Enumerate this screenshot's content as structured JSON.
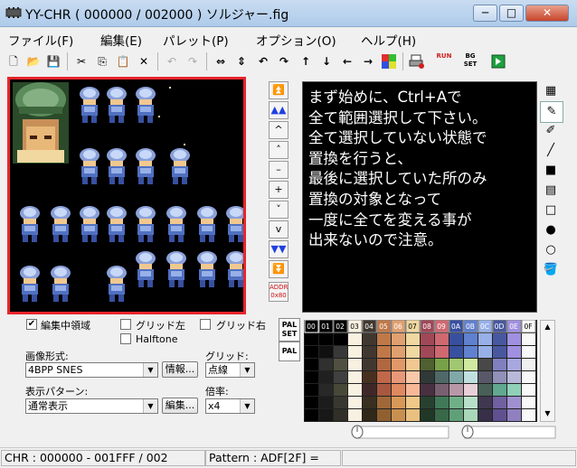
{
  "window": {
    "title": "YY-CHR ( 000000 / 002000 ) ソルジャー.fig",
    "min_glyph": "─",
    "max_glyph": "□",
    "close_glyph": "✕"
  },
  "menu": [
    "ファイル(F)",
    "編集(E)",
    "パレット(P)",
    "オプション(O)",
    "ヘルプ(H)"
  ],
  "toolbar": {
    "new": "🗋",
    "open": "📂",
    "save": "💾",
    "cut": "✂",
    "copy": "⎘",
    "paste": "📋",
    "delete": "✕",
    "undo": "↶",
    "redo": "↷",
    "flip_h": "⇔",
    "flip_v": "⇕",
    "rot_l": "↶",
    "rot_r": "↷",
    "up": "↑",
    "down": "↓",
    "left": "←",
    "right": "→",
    "bg_label": "BG SET",
    "run_label": "RUN"
  },
  "scroll_buttons": [
    "⏫",
    "▲▲",
    "^",
    "˄",
    "–",
    "+",
    "˅",
    "v",
    "▼▼",
    "⏬"
  ],
  "addr_button": {
    "line1": "ADDR",
    "line2": "0x80"
  },
  "edit_panel": {
    "text": "まず始めに、Ctrl+Aで\n全て範囲選択して下さい。\n全て選択していない状態で\n置換を行うと、\n最後に選択していた所のみ\n置換の対象となって\n一度に全てを変える事が\n出来ないので注意。"
  },
  "tools": [
    "▦",
    "✎",
    "✐",
    "╱",
    "■",
    "▤",
    "□",
    "●",
    "○",
    "🪣"
  ],
  "options": {
    "edit_region": {
      "label": "編集中領域",
      "checked": true
    },
    "grid_left": {
      "label": "グリッド左",
      "checked": false
    },
    "grid_right": {
      "label": "グリッド右",
      "checked": false
    },
    "halftone": {
      "label": "Halftone",
      "checked": false
    },
    "image_format_label": "画像形式:",
    "image_format_value": "4BPP SNES",
    "info_button": "情報...",
    "grid_label": "グリッド:",
    "grid_value": "点線",
    "display_pattern_label": "表示パターン:",
    "display_pattern_value": "通常表示",
    "edit_button": "編集...",
    "zoom_label": "倍率:",
    "zoom_value": "x4",
    "check_glyph": "✔"
  },
  "palette": {
    "set_label": "PAL SET",
    "pal_label": "PAL",
    "header": [
      "00",
      "01",
      "02",
      "03",
      "04",
      "05",
      "06",
      "07",
      "08",
      "09",
      "0A",
      "0B",
      "0C",
      "0D",
      "0E",
      "0F"
    ],
    "selected_index": 0,
    "rows": [
      [
        "#000000",
        "#000000",
        "#000000",
        "#f8f0e0",
        "#403830",
        "#c07848",
        "#e0a070",
        "#f0d8a0",
        "#a04858",
        "#d06870",
        "#3850a0",
        "#6080d0",
        "#98b0e8",
        "#4858a0",
        "#a090e0",
        "#f8f8f8"
      ],
      [
        "#000000",
        "#101010",
        "#383838",
        "#f8f0e0",
        "#403830",
        "#c07848",
        "#e0a070",
        "#f0d8a0",
        "#a04858",
        "#d06870",
        "#3850a0",
        "#6080d0",
        "#98b0e8",
        "#4858a0",
        "#a090e0",
        "#f8f8f8"
      ],
      [
        "#000000",
        "#303030",
        "#505040",
        "#f8f0e0",
        "#403830",
        "#b06840",
        "#e09868",
        "#f0c890",
        "#506030",
        "#78a048",
        "#a0c870",
        "#d0e8a0",
        "#484848",
        "#8080c0",
        "#a8a8e0",
        "#f0f0f0"
      ],
      [
        "#000000",
        "#202020",
        "#404040",
        "#f8f0e0",
        "#483020",
        "#c06848",
        "#e89878",
        "#f8c8a8",
        "#303838",
        "#506868",
        "#80a8a8",
        "#c0e0e0",
        "#585868",
        "#9090b8",
        "#b8b8d8",
        "#f8f8f8"
      ],
      [
        "#000000",
        "#282828",
        "#484838",
        "#f8f0e0",
        "#402828",
        "#a85840",
        "#e08860",
        "#f8b898",
        "#483040",
        "#786070",
        "#b898a8",
        "#e8d0d8",
        "#486058",
        "#60a890",
        "#90d0b8",
        "#f8f8f8"
      ],
      [
        "#000000",
        "#1c1c1c",
        "#383830",
        "#f8f0e0",
        "#383020",
        "#a06838",
        "#d89858",
        "#f0c888",
        "#284030",
        "#407858",
        "#70b088",
        "#b8e0c8",
        "#403850",
        "#7060a0",
        "#a090d0",
        "#f8f8f8"
      ],
      [
        "#000000",
        "#181818",
        "#303028",
        "#f8f0e0",
        "#302818",
        "#906030",
        "#c89050",
        "#e8c080",
        "#203828",
        "#386848",
        "#60a078",
        "#a8d8b8",
        "#383048",
        "#605090",
        "#9080c0",
        "#f8f8f8"
      ]
    ]
  },
  "status": {
    "chr": "CHR : 000000 - 001FFF / 002",
    "pattern": "Pattern : ADF[2F] ="
  }
}
